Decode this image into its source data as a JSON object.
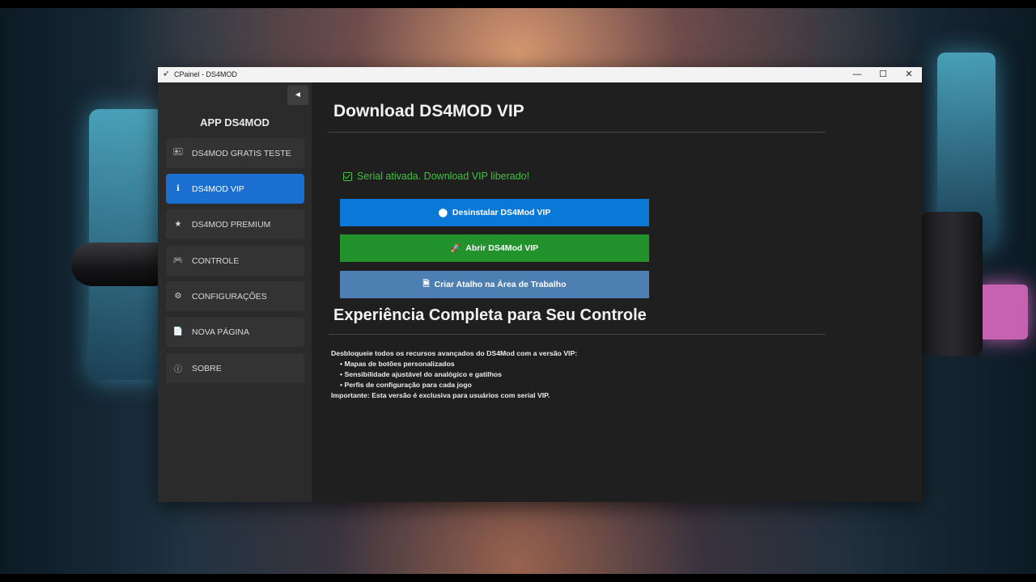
{
  "window": {
    "title": "CPainel - DS4MOD",
    "controls": {
      "minimize": "—",
      "maximize": "☐",
      "close": "✕"
    }
  },
  "sidebar": {
    "collapse_glyph": "◄",
    "brand": "APP DS4MOD",
    "items": [
      {
        "label": "DS4MOD GRATIS TESTE",
        "icon": "🖭",
        "icon_name": "card-icon",
        "active": false
      },
      {
        "label": "DS4MOD VIP",
        "icon": "ℹ",
        "icon_name": "info-icon",
        "active": true
      },
      {
        "label": "DS4MOD PREMIUM",
        "icon": "★",
        "icon_name": "star-icon",
        "active": false
      },
      {
        "label": "CONTROLE",
        "icon": "🎮",
        "icon_name": "gamepad-icon",
        "active": false
      },
      {
        "label": "CONFIGURAÇÕES",
        "icon": "⚙",
        "icon_name": "gear-icon",
        "active": false
      },
      {
        "label": "NOVA PÁGINA",
        "icon": "📄",
        "icon_name": "document-icon",
        "active": false
      },
      {
        "label": "SOBRE",
        "icon": "ⓘ",
        "icon_name": "about-icon",
        "active": false
      }
    ]
  },
  "main": {
    "title": "Download DS4MOD VIP",
    "status": "Serial ativada. Download VIP liberado!",
    "buttons": {
      "uninstall": {
        "icon": "⬤",
        "label": "Desinstalar DS4Mod VIP"
      },
      "open": {
        "icon": "🚀",
        "label": "Abrir DS4Mod VIP"
      },
      "shortcut": {
        "icon": "🗎",
        "label": "Criar Atalho na Área de Trabalho"
      }
    },
    "section_title": "Experiência Completa para Seu Controle",
    "description": {
      "intro": "Desbloqueie todos os recursos avançados do DS4Mod com a versão VIP:",
      "bullets": [
        "• Mapas de botões personalizados",
        "• Sensibilidade ajustável do analógico e gatilhos",
        "• Perfis de configuração para cada jogo"
      ],
      "note": "Importante: Esta versão é exclusiva para usuários com serial VIP."
    }
  },
  "colors": {
    "accent_blue": "#0a78d7",
    "nav_active": "#1a6fd1",
    "green": "#22922c",
    "steel": "#4d7fb2",
    "status_green": "#3fc23f"
  }
}
